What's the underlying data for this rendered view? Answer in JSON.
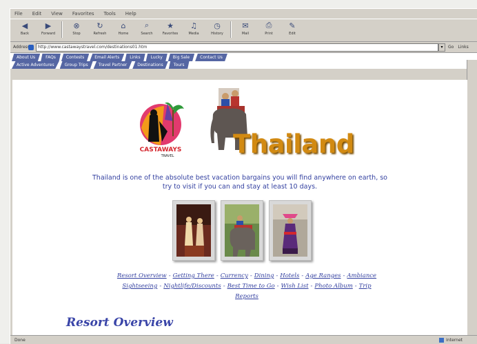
{
  "browser": {
    "menu": [
      "File",
      "Edit",
      "View",
      "Favorites",
      "Tools",
      "Help"
    ],
    "toolbar": [
      {
        "label": "Back",
        "icon": "back-arrow-icon"
      },
      {
        "label": "Forward",
        "icon": "forward-arrow-icon"
      },
      {
        "label": "Stop",
        "icon": "stop-icon"
      },
      {
        "label": "Refresh",
        "icon": "refresh-icon"
      },
      {
        "label": "Home",
        "icon": "home-icon"
      },
      {
        "label": "Search",
        "icon": "search-icon"
      },
      {
        "label": "Favorites",
        "icon": "favorites-icon"
      },
      {
        "label": "Media",
        "icon": "media-icon"
      },
      {
        "label": "History",
        "icon": "history-icon"
      },
      {
        "label": "Mail",
        "icon": "mail-icon"
      },
      {
        "label": "Print",
        "icon": "print-icon"
      },
      {
        "label": "Edit",
        "icon": "edit-icon"
      }
    ],
    "address_label": "Address",
    "address_url": "http://www.castawaystravel.com/destinations01.htm",
    "go_label": "Go",
    "links_label": "Links",
    "status_text": "Done",
    "zone_text": "Internet"
  },
  "nav": {
    "row1": [
      "About Us",
      "FAQs",
      "Contests",
      "Email Alerts",
      "Links",
      "Lucky",
      "Big Sale",
      "Contact Us"
    ],
    "row2": [
      "Active Adventures",
      "Group Trips",
      "Travel Partner",
      "Destinations",
      "Tours"
    ]
  },
  "page": {
    "logo_text": "CASTAWAYS",
    "logo_sub": "TRAVEL",
    "title": "Thailand",
    "intro": "Thailand is one of the absolute best vacation bargains you will find anywhere on earth, so try to visit if you can and stay at least 10 days.",
    "links_row1": [
      "Resort Overview",
      "Getting There",
      "Currency",
      "Dining",
      "Hotels",
      "Age Ranges",
      "Ambiance"
    ],
    "links_row2": [
      "Sightseeing",
      "Nightlife/Discounts",
      "Best Time to Go",
      "Wish List",
      "Photo Album",
      "Trip Reports"
    ],
    "section_heading": "Resort Overview"
  },
  "colors": {
    "nav_tab": "#5566a3",
    "text_blue": "#3340a0",
    "title_gold": "#d28a12"
  }
}
